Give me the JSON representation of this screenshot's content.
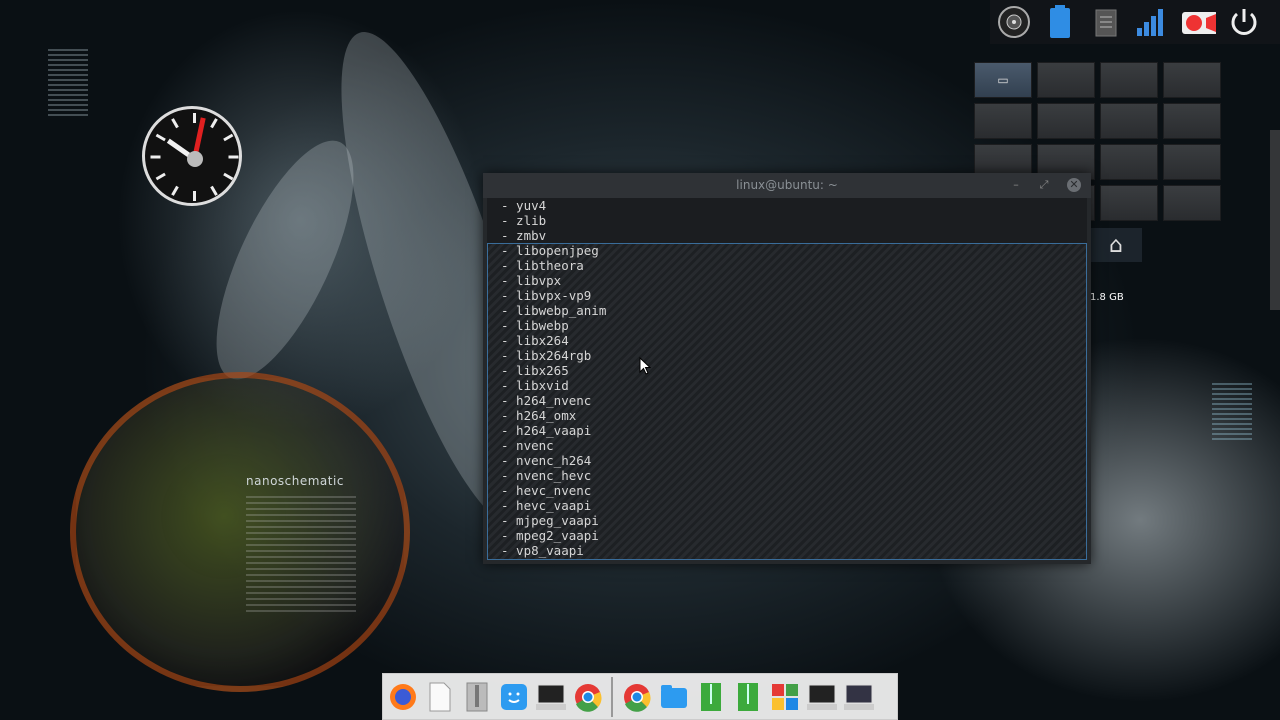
{
  "terminal": {
    "title": "linux@ubuntu: ~",
    "lines": [
      "- yuv4",
      "- zlib",
      "- zmbv",
      "- libopenjpeg",
      "- libtheora",
      "- libvpx",
      "- libvpx-vp9",
      "- libwebp_anim",
      "- libwebp",
      "- libx264",
      "- libx264rgb",
      "- libx265",
      "- libxvid",
      "- h264_nvenc",
      "- h264_omx",
      "- h264_vaapi",
      "- nvenc",
      "- nvenc_h264",
      "- nvenc_hevc",
      "- hevc_nvenc",
      "- hevc_vaapi",
      "- mjpeg_vaapi",
      "- mpeg2_vaapi",
      "- vp8_vaapi"
    ],
    "buttons": {
      "minimize": "–",
      "maximize": "⤢",
      "close": "✕"
    }
  },
  "desktop": {
    "widget_label": "nanoschematic",
    "disk_label": "1.8 GB",
    "home_icon": "home-icon"
  },
  "tray": {
    "icons": [
      "speaker-icon",
      "battery-icon",
      "clipboard-icon",
      "signal-icon",
      "record-icon",
      "power-icon"
    ]
  },
  "dock": {
    "left_icons": [
      "firefox-icon",
      "text-file-icon",
      "archive-icon",
      "finder-icon",
      "terminal-icon",
      "chrome-icon"
    ],
    "right_icons": [
      "chrome-icon",
      "folder-icon",
      "zip-icon",
      "zip-icon",
      "apps-icon",
      "terminal-icon",
      "terminal-icon"
    ]
  },
  "colors": {
    "selection_border": "#3a6d9a",
    "terminal_bg": "#1b1d20",
    "clock_hand": "#e02020"
  }
}
